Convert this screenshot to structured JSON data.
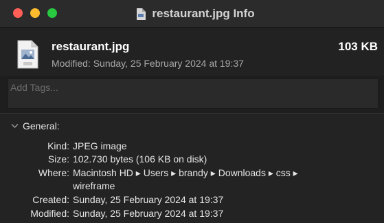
{
  "window": {
    "title": "restaurant.jpg Info"
  },
  "header": {
    "file_name": "restaurant.jpg",
    "file_size": "103 KB",
    "modified": "Modified: Sunday, 25 February 2024 at 19:37"
  },
  "tags": {
    "placeholder": "Add Tags..."
  },
  "general": {
    "title": "General:",
    "kind_label": "Kind:",
    "kind_value": "JPEG image",
    "size_label": "Size:",
    "size_value": "102.730 bytes (106 KB on disk)",
    "where_label": "Where:",
    "where_line1": "Macintosh HD ▸ Users ▸ brandy ▸ Downloads ▸ css ▸",
    "where_line2": "wireframe",
    "created_label": "Created:",
    "created_value": "Sunday, 25 February 2024 at 19:37",
    "modified_label": "Modified:",
    "modified_value": "Sunday, 25 February 2024 at 19:37"
  },
  "colors": {
    "close": "#ff5f57",
    "minimize": "#febc2e",
    "zoom": "#28c840",
    "background": "#1e1e1e"
  },
  "icons": {
    "title_icon": "document-icon",
    "file_icon": "jpeg-file-icon",
    "section_toggle": "chevron-down-icon"
  }
}
